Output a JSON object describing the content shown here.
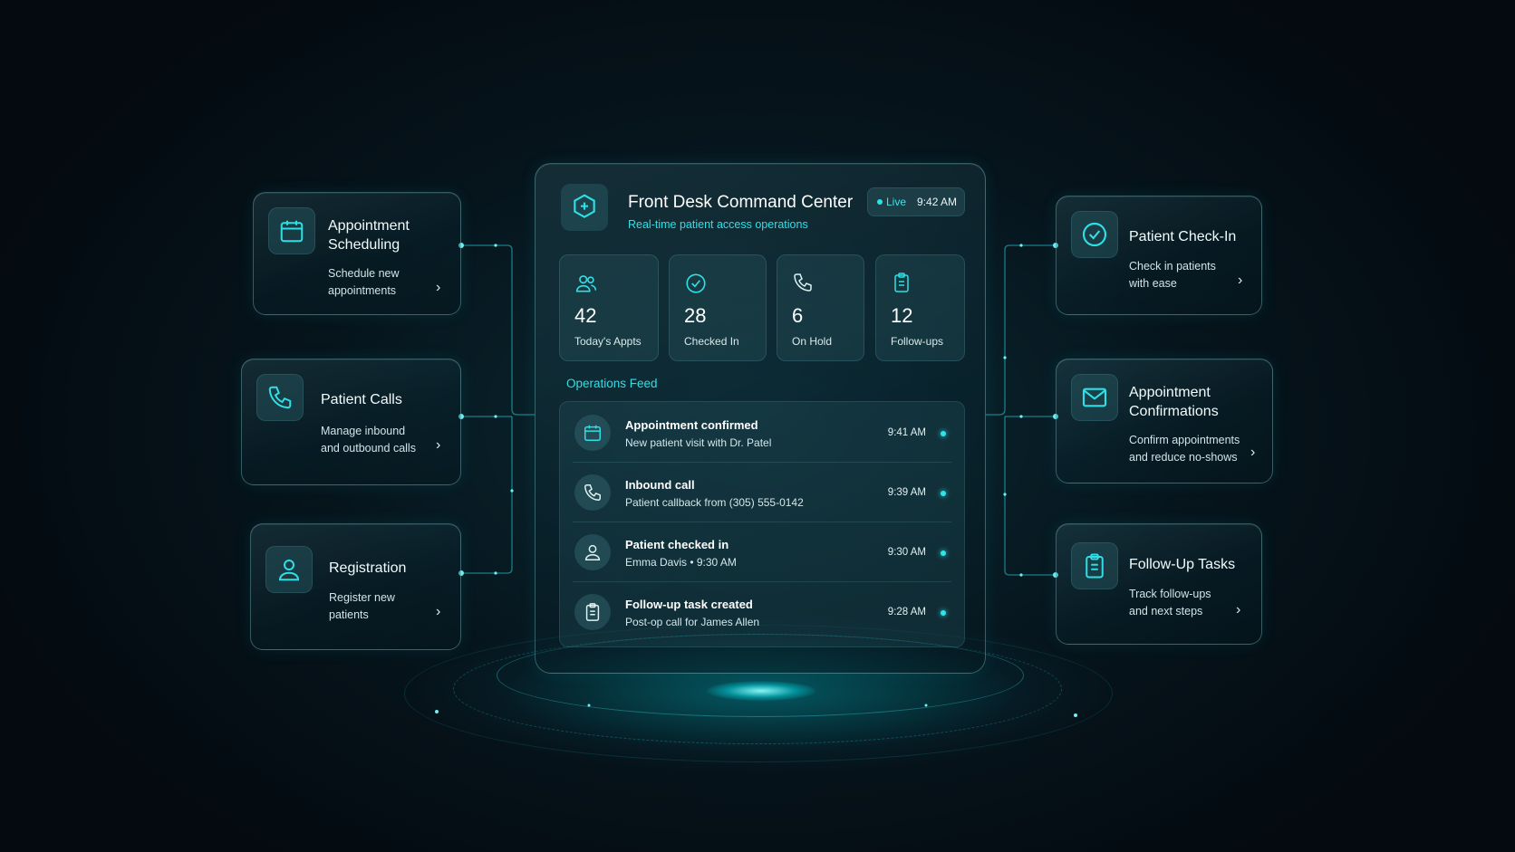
{
  "colors": {
    "accent": "#2ee0e6",
    "background": "#06141c",
    "text": "#e8f6f7"
  },
  "main": {
    "logo_icon": "medical-cross-icon",
    "title": "Front Desk Command Center",
    "subtitle": "Real-time patient access operations",
    "live_label": "Live",
    "time": "9:42 AM",
    "stats": [
      {
        "icon": "users-icon",
        "value": "42",
        "label": "Today's Appts"
      },
      {
        "icon": "check-circle-icon",
        "value": "28",
        "label": "Checked In"
      },
      {
        "icon": "phone-icon",
        "value": "6",
        "label": "On Hold"
      },
      {
        "icon": "clipboard-icon",
        "value": "12",
        "label": "Follow-ups"
      }
    ],
    "feed_title": "Operations Feed",
    "feed": [
      {
        "icon": "calendar-icon",
        "title": "Appointment confirmed",
        "detail": "New patient visit with Dr. Patel",
        "time": "9:41 AM"
      },
      {
        "icon": "phone-icon",
        "title": "Inbound call",
        "detail": "Patient callback from (305) 555-0142",
        "time": "9:39 AM"
      },
      {
        "icon": "user-icon",
        "title": "Patient checked in",
        "detail": "Emma Davis • 9:30 AM",
        "time": "9:30 AM"
      },
      {
        "icon": "clipboard-icon",
        "title": "Follow-up task created",
        "detail": "Post-op call for James Allen",
        "time": "9:28 AM"
      }
    ]
  },
  "left_cards": [
    {
      "icon": "calendar-icon",
      "title_line1": "Appointment",
      "title_line2": "Scheduling",
      "desc_line1": "Schedule new",
      "desc_line2": "appointments"
    },
    {
      "icon": "phone-icon",
      "title_line1": "Patient Calls",
      "title_line2": "",
      "desc_line1": "Manage inbound",
      "desc_line2": "and outbound calls"
    },
    {
      "icon": "user-icon",
      "title_line1": "Registration",
      "title_line2": "",
      "desc_line1": "Register new",
      "desc_line2": "patients"
    }
  ],
  "right_cards": [
    {
      "icon": "check-circle-icon",
      "title_line1": "Patient Check-In",
      "title_line2": "",
      "desc_line1": "Check in patients",
      "desc_line2": "with ease"
    },
    {
      "icon": "envelope-icon",
      "title_line1": "Appointment",
      "title_line2": "Confirmations",
      "desc_line1": "Confirm appointments",
      "desc_line2": "and reduce no-shows"
    },
    {
      "icon": "clipboard-icon",
      "title_line1": "Follow-Up Tasks",
      "title_line2": "",
      "desc_line1": "Track follow-ups",
      "desc_line2": "and next steps"
    }
  ],
  "chevron": "›"
}
